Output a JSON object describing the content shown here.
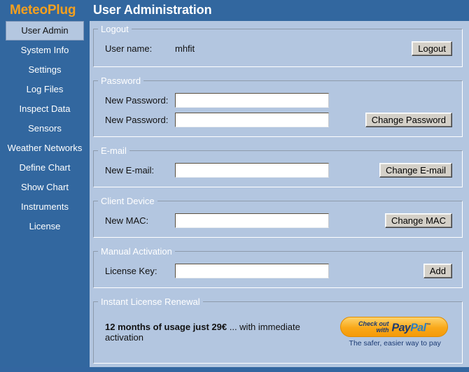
{
  "header": {
    "brand": "MeteoPlug",
    "page_title": "User Administration",
    "brand_color": "#f5a01e",
    "bar_color": "#32679f"
  },
  "sidebar": {
    "items": [
      {
        "label": "User Admin",
        "active": true
      },
      {
        "label": "System Info",
        "active": false
      },
      {
        "label": "Settings",
        "active": false
      },
      {
        "label": "Log Files",
        "active": false
      },
      {
        "label": "Inspect Data",
        "active": false
      },
      {
        "label": "Sensors",
        "active": false
      },
      {
        "label": "Weather Networks",
        "active": false
      },
      {
        "label": "Define Chart",
        "active": false
      },
      {
        "label": "Show Chart",
        "active": false
      },
      {
        "label": "Instruments",
        "active": false
      },
      {
        "label": "License",
        "active": false
      }
    ]
  },
  "sections": {
    "logout": {
      "legend": "Logout",
      "user_label": "User name:",
      "user_value": "mhfit",
      "button": "Logout"
    },
    "password": {
      "legend": "Password",
      "label_1": "New Password:",
      "label_2": "New Password:",
      "value_1": "",
      "value_2": "",
      "placeholder_1": "",
      "placeholder_2": "",
      "button": "Change Password"
    },
    "email": {
      "legend": "E-mail",
      "label": "New E-mail:",
      "value": "",
      "placeholder": "",
      "button": "Change E-mail"
    },
    "client_device": {
      "legend": "Client Device",
      "label": "New MAC:",
      "value": "",
      "placeholder": "",
      "button": "Change MAC"
    },
    "manual_activation": {
      "legend": "Manual Activation",
      "label": "License Key:",
      "value": "",
      "placeholder": "",
      "button": "Add"
    },
    "renewal": {
      "legend": "Instant License Renewal",
      "offer_bold": "12 months of usage just 29€",
      "offer_rest": " ... with immediate activation",
      "paypal_checkout": "Check out",
      "paypal_with": "with",
      "paypal_pay": "Pay",
      "paypal_pal": "Pal",
      "paypal_tagline": "The safer, easier way to pay"
    }
  }
}
